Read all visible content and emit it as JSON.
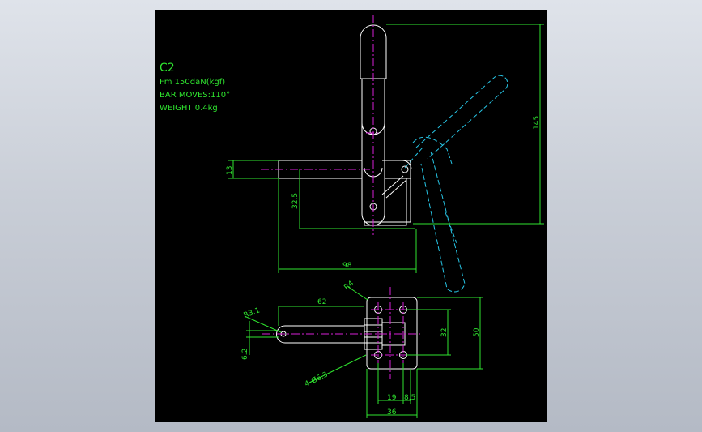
{
  "colors": {
    "background": "#000000",
    "outline": "#ffffff",
    "dimension": "#2fe52f",
    "centerline": "#d61fd6",
    "phantom": "#27c6e6"
  },
  "notes": {
    "model": "C2",
    "force": "Fm 150daN(kgf)",
    "bar_moves": "BAR MOVES:110°",
    "weight": "WEIGHT 0.4kg"
  },
  "dimensions": {
    "height_145": "145",
    "bar_thick_13": "13",
    "base_32_5": "32.5",
    "length_98": "98",
    "radius_r4": "R4",
    "length_62": "62",
    "radius_r3_1": "R3.1",
    "thick_6_2": "6.2",
    "holes_4_d6_3": "4-Ø6.3",
    "pitch_32": "32",
    "width_50": "50",
    "pitch_19": "19",
    "offset_8_5": "8.5",
    "width_36": "36"
  }
}
